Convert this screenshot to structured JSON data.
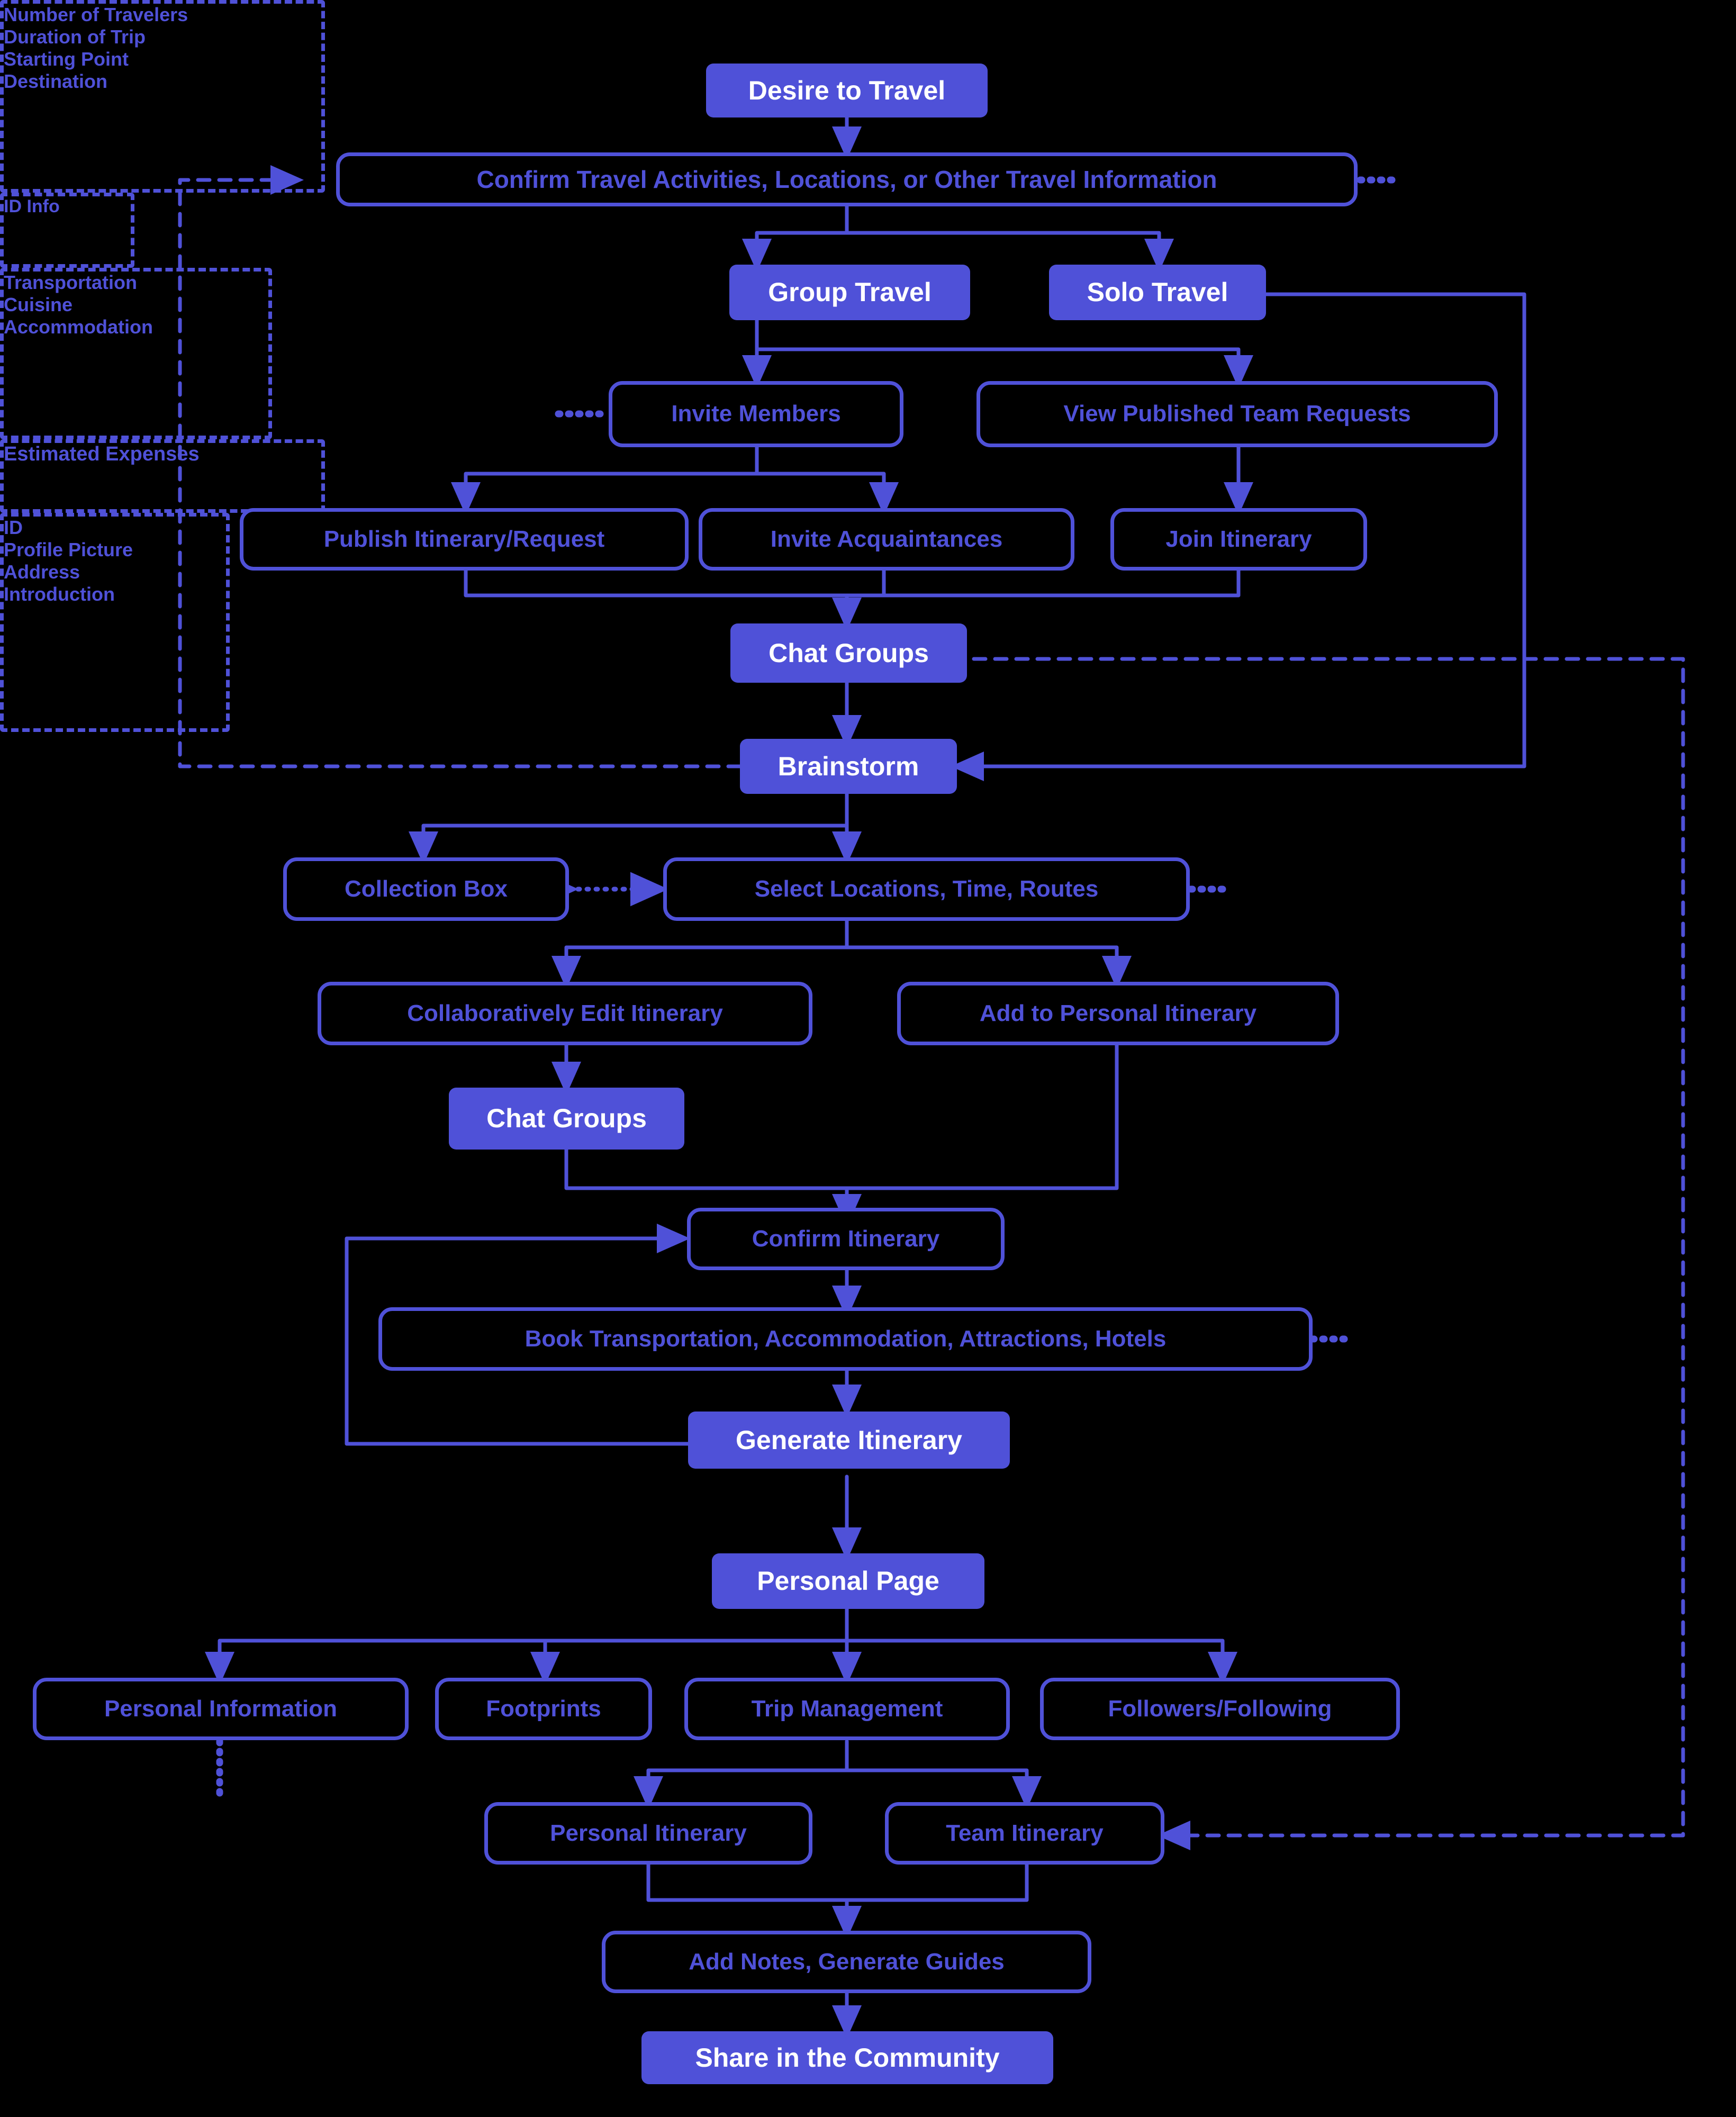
{
  "diagram": {
    "title": "Travel Planning App User Flow",
    "accent": "#4f51d8",
    "background": "#000000",
    "text_on_filled": "#ffffff"
  },
  "nodes": {
    "desire": "Desire to Travel",
    "confirm_info": "Confirm Travel Activities, Locations, or Other Travel Information",
    "group_travel": "Group Travel",
    "solo_travel": "Solo Travel",
    "id_info": "ID Info",
    "invite_members": "Invite Members",
    "view_requests": "View Published Team Requests",
    "publish_request": "Publish Itinerary/Request",
    "invite_acq": "Invite Acquaintances",
    "join_itinerary": "Join Itinerary",
    "chat_groups_1": "Chat Groups",
    "brainstorm": "Brainstorm",
    "collection_box": "Collection Box",
    "select_locations": "Select Locations, Time, Routes",
    "collab_edit": "Collaboratively Edit Itinerary",
    "add_personal": "Add to Personal Itinerary",
    "chat_groups_2": "Chat Groups",
    "confirm_itinerary": "Confirm Itinerary",
    "book": "Book Transportation, Accommodation, Attractions, Hotels",
    "estimated_expenses": "Estimated Expenses",
    "generate_itinerary": "Generate Itinerary",
    "personal_page": "Personal Page",
    "personal_information": "Personal Information",
    "footprints": "Footprints",
    "trip_management": "Trip Management",
    "followers": "Followers/Following",
    "personal_itinerary": "Personal Itinerary",
    "team_itinerary": "Team Itinerary",
    "add_notes": "Add Notes, Generate Guides",
    "share_community": "Share in the Community"
  },
  "notes": {
    "trip_params": [
      "Number of Travelers",
      "Duration of Trip",
      "Starting Point",
      "Destination"
    ],
    "preferences": [
      "Transportation",
      "Cuisine",
      "Accommodation"
    ],
    "profile_fields": [
      "ID",
      "Profile Picture",
      "Address",
      "Introduction"
    ]
  }
}
